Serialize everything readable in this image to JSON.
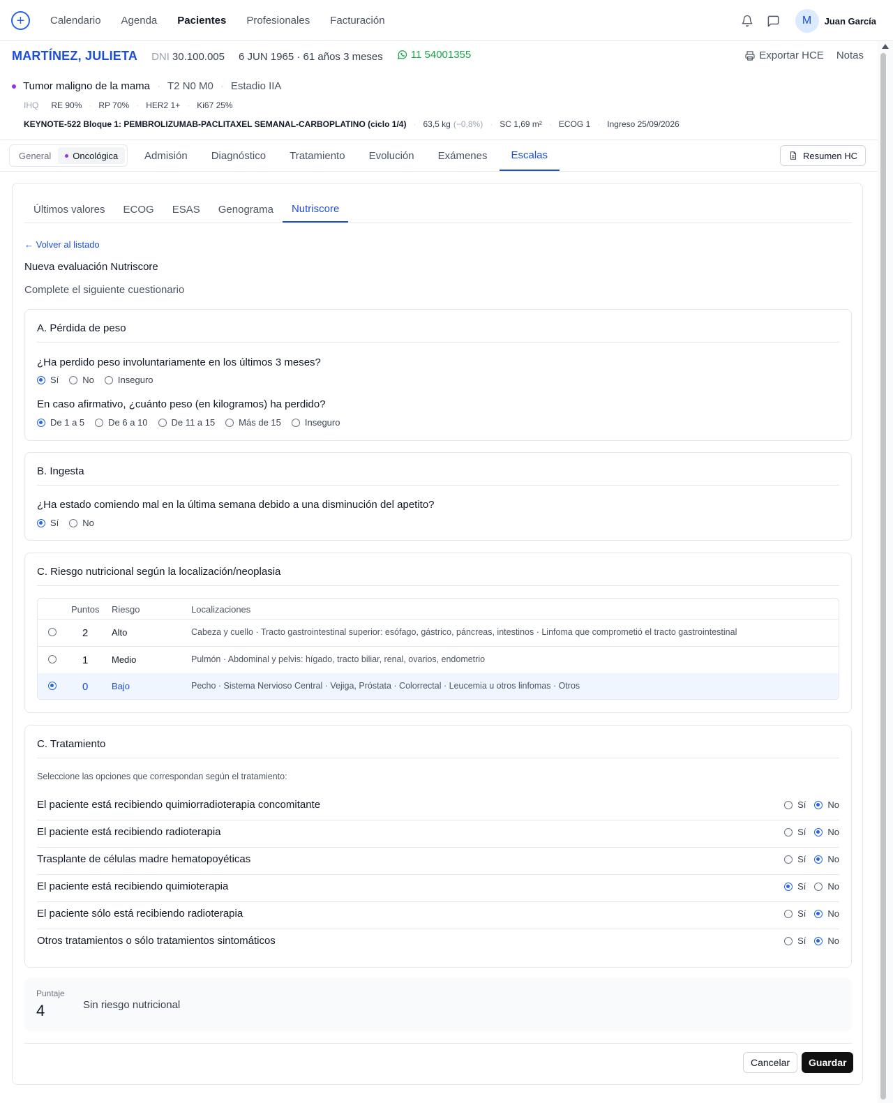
{
  "nav": {
    "items": [
      "Calendario",
      "Agenda",
      "Pacientes",
      "Profesionales",
      "Facturación"
    ],
    "active": "Pacientes",
    "avatar_initial": "M",
    "user_name": "Juan García"
  },
  "patient": {
    "name": "MARTÍNEZ, JULIETA",
    "dni_label": "DNI",
    "dni": "30.100.005",
    "dob_age": "6 JUN 1965 · 61 años 3 meses",
    "phone": "11 54001355",
    "export_label": "Exportar HCE",
    "notes_label": "Notas",
    "diagnosis": "Tumor maligno de la mama",
    "tnm": "T2 N0 M0",
    "stage": "Estadio IIA",
    "ihq_label": "IHQ",
    "ihq": [
      "RE 90%",
      "RP 70%",
      "HER2 1+",
      "Ki67 25%"
    ],
    "protocol": "KEYNOTE-522 Bloque 1: PEMBROLIZUMAB-PACLITAXEL SEMANAL-CARBOPLATINO (ciclo 1/4)",
    "weight": "63,5 kg",
    "weight_delta": "(−0,8%)",
    "bsa": "SC 1,69 m²",
    "ecog": "ECOG 1",
    "admission": "Ingreso 25/09/2026"
  },
  "context_tabs": {
    "general": "General",
    "onco": "Oncológica"
  },
  "main_tabs": [
    "Admisión",
    "Diagnóstico",
    "Tratamiento",
    "Evolución",
    "Exámenes",
    "Escalas"
  ],
  "main_tab_active": "Escalas",
  "resumen_label": "Resumen HC",
  "sub_tabs": [
    "Últimos valores",
    "ECOG",
    "ESAS",
    "Genograma",
    "Nutriscore"
  ],
  "sub_tab_active": "Nutriscore",
  "back_link": "← Volver al listado",
  "form_title": "Nueva evaluación Nutriscore",
  "form_subtitle": "Complete el siguiente cuestionario",
  "section_a": {
    "title": "A. Pérdida de peso",
    "q1": "¿Ha perdido peso involuntariamente en los últimos 3 meses?",
    "q1_options": [
      "Sí",
      "No",
      "Inseguro"
    ],
    "q1_selected": "Sí",
    "q2": "En caso afirmativo, ¿cuánto peso (en kilogramos) ha perdido?",
    "q2_options": [
      "De 1 a 5",
      "De 6 a 10",
      "De 11 a 15",
      "Más de 15",
      "Inseguro"
    ],
    "q2_selected": "De 1 a 5"
  },
  "section_b": {
    "title": "B. Ingesta",
    "q1": "¿Ha estado comiendo mal en la última semana debido a una disminución del apetito?",
    "q1_options": [
      "Sí",
      "No"
    ],
    "q1_selected": "Sí"
  },
  "section_c": {
    "title": "C. Riesgo nutricional según la localización/neoplasia",
    "headers": [
      "Puntos",
      "Riesgo",
      "Localizaciones"
    ],
    "rows": [
      {
        "points": "2",
        "risk": "Alto",
        "locations": "Cabeza y cuello · Tracto gastrointestinal superior: esófago, gástrico, páncreas, intestinos · Linfoma que comprometió el tracto gastrointestinal",
        "selected": false
      },
      {
        "points": "1",
        "risk": "Medio",
        "locations": "Pulmón · Abdominal y pelvis: hígado, tracto biliar, renal, ovarios, endometrio",
        "selected": false
      },
      {
        "points": "0",
        "risk": "Bajo",
        "locations": "Pecho · Sistema Nervioso Central · Vejiga, Próstata · Colorrectal · Leucemia u otros linfomas · Otros",
        "selected": true
      }
    ]
  },
  "section_t": {
    "title": "C. Tratamiento",
    "hint": "Seleccione las opciones que correspondan según el tratamiento:",
    "yes_label": "Sí",
    "no_label": "No",
    "rows": [
      {
        "label": "El paciente está recibiendo quimiorradioterapia concomitante",
        "value": "No"
      },
      {
        "label": "El paciente está recibiendo radioterapia",
        "value": "No"
      },
      {
        "label": "Trasplante de células madre hematopoyéticas",
        "value": "No"
      },
      {
        "label": "El paciente está recibiendo quimioterapia",
        "value": "Sí"
      },
      {
        "label": "El paciente sólo está recibiendo radioterapia",
        "value": "No"
      },
      {
        "label": "Otros tratamientos o sólo tratamientos sintomáticos",
        "value": "No"
      }
    ]
  },
  "score": {
    "label": "Puntaje",
    "value": "4",
    "interpretation": "Sin riesgo nutricional"
  },
  "actions": {
    "cancel": "Cancelar",
    "save": "Guardar"
  },
  "colors": {
    "primary": "#1d4ed8",
    "whatsapp": "#16a34a",
    "onco_dot": "#9333ea",
    "save_bg": "#111111"
  }
}
